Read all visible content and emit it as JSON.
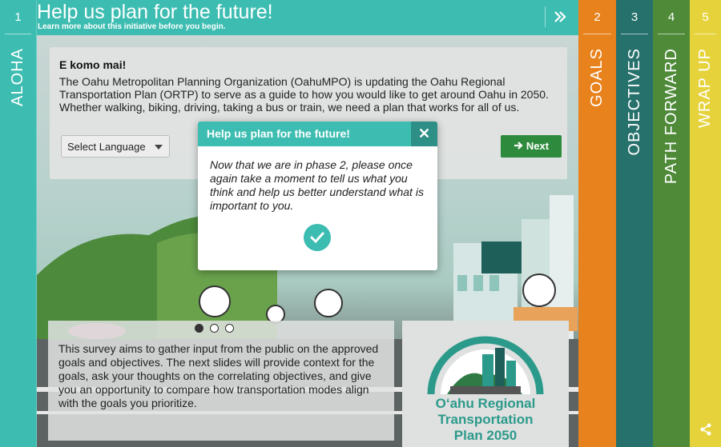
{
  "header": {
    "title": "Help us plan for the future!",
    "subtitle": "Learn more about this initiative before you begin."
  },
  "rail": {
    "number": "1",
    "label": "ALOHA"
  },
  "intro": {
    "heading": "E komo mai!",
    "text": "The Oahu Metropolitan Planning Organization (OahuMPO) is updating the Oahu Regional Transportation Plan (ORTP) to serve as a guide to how you would like to get around Oahu in 2050. Whether walking, biking, driving, taking a bus or train, we need a plan that works for all of us.",
    "language_select": "Select Language",
    "next_label": "Next"
  },
  "bottom": {
    "text": "This survey aims to gather input from the public on the approved goals and objectives. The next slides will provide context for the goals, ask your thoughts on the correlating objectives, and give you an opportunity to compare how transportation modes align with the goals you prioritize."
  },
  "logo": {
    "line1": "O‘ahu Regional",
    "line2": "Transportation",
    "line3": "Plan 2050"
  },
  "modal": {
    "title": "Help us plan for the future!",
    "body": "Now that we are in phase 2, please once again take a moment to tell us what you think and help us better understand what is important to you.",
    "close": "✕"
  },
  "tabs": [
    {
      "number": "2",
      "label": "GOALS"
    },
    {
      "number": "3",
      "label": "OBJECTIVES"
    },
    {
      "number": "4",
      "label": "PATH FORWARD"
    },
    {
      "number": "5",
      "label": "WRAP UP"
    }
  ],
  "icons": {
    "collapse": "double-chevron-right-icon",
    "next": "arrow-right-icon",
    "ok": "check-icon",
    "share": "share-icon"
  },
  "colors": {
    "teal": "#3dbdb1",
    "orange": "#e8821c",
    "dark_teal": "#27716c",
    "green": "#4e8a38",
    "yellow": "#e6d33c",
    "next_green": "#2e8b3d"
  }
}
